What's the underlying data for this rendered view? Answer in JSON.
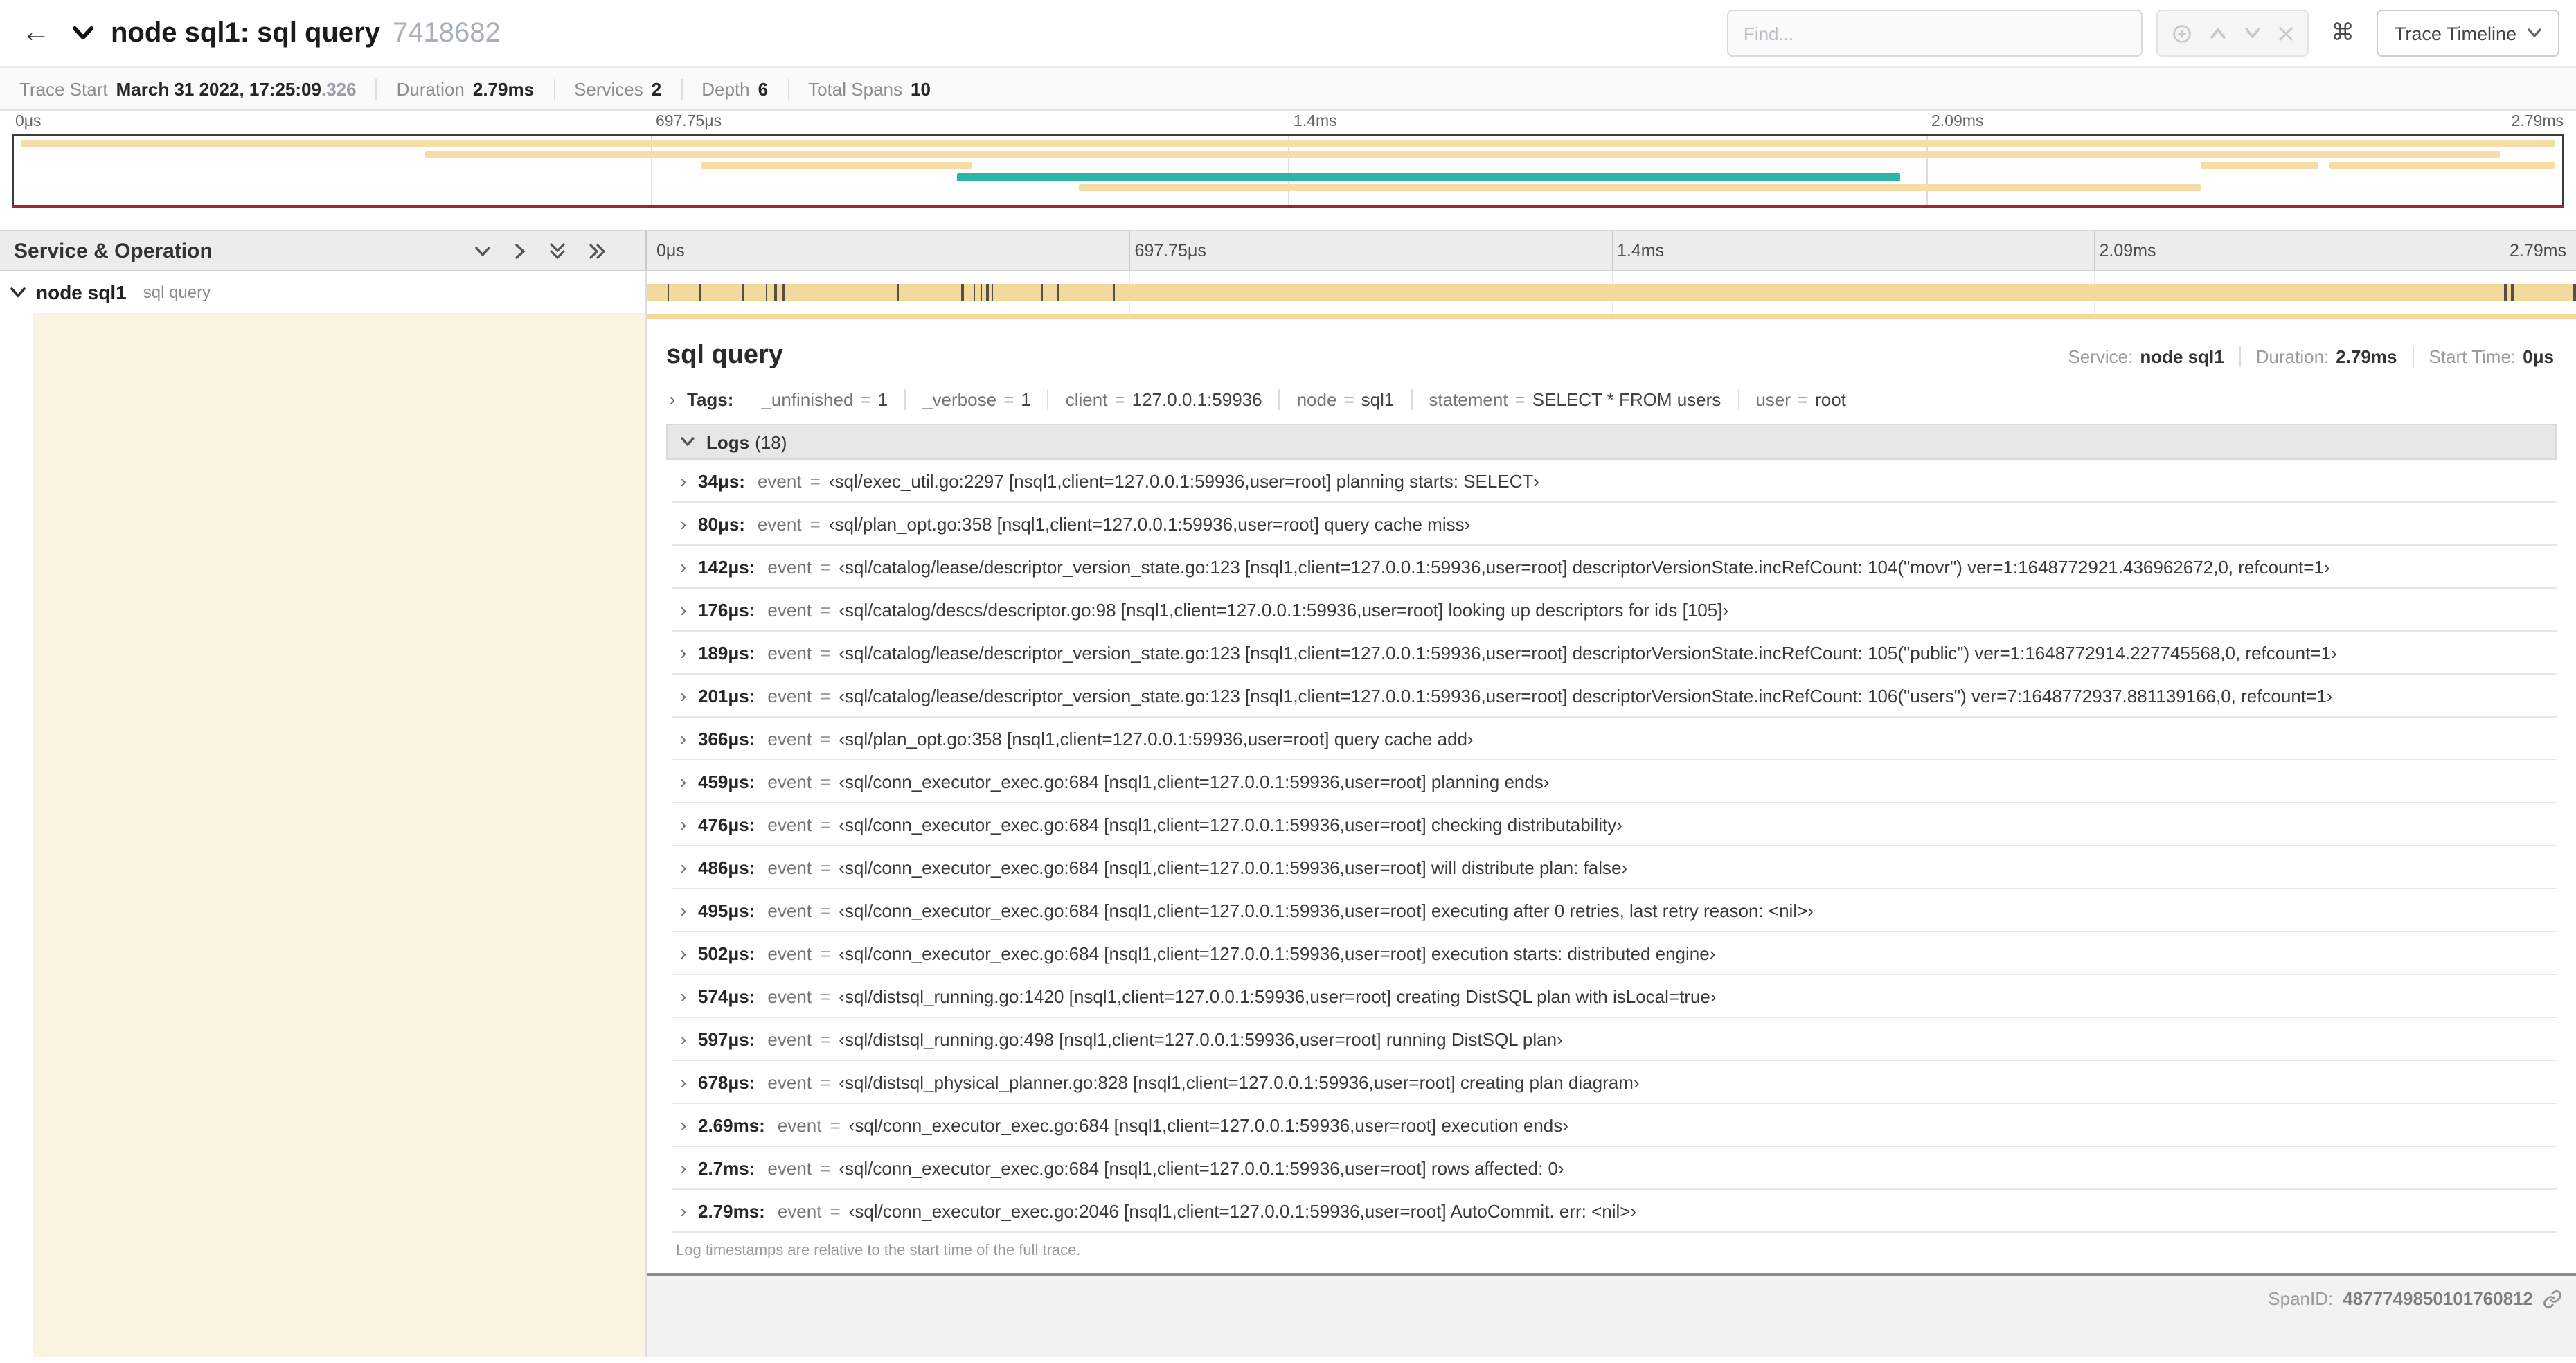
{
  "header": {
    "back_glyph": "←",
    "title": "node sql1: sql query",
    "trace_id": "7418682",
    "find_placeholder": "Find...",
    "cmd_glyph": "⌘",
    "trace_timeline_label": "Trace Timeline"
  },
  "summary": {
    "trace_start_label": "Trace Start",
    "trace_start_value": "March 31 2022, 17:25:09",
    "trace_start_suffix": ".326",
    "duration_label": "Duration",
    "duration_value": "2.79ms",
    "services_label": "Services",
    "services_value": "2",
    "depth_label": "Depth",
    "depth_value": "6",
    "spans_label": "Total Spans",
    "spans_value": "10"
  },
  "timeline": {
    "duration_us": 2790,
    "ticks": [
      "0μs",
      "697.75μs",
      "1.4ms",
      "2.09ms",
      "2.79ms"
    ]
  },
  "minimap": {
    "colors": {
      "tan": "#f5dda5",
      "teal": "#2ab5a7"
    },
    "bars": [
      {
        "r": 0,
        "l": 0.3,
        "w": 99.4,
        "c": "tan"
      },
      {
        "r": 1,
        "l": 16.2,
        "w": 81.3,
        "c": "tan"
      },
      {
        "r": 2,
        "l": 27.0,
        "w": 10.6,
        "c": "tan"
      },
      {
        "r": 2,
        "l": 85.8,
        "w": 4.6,
        "c": "tan"
      },
      {
        "r": 2,
        "l": 90.8,
        "w": 8.9,
        "c": "tan"
      },
      {
        "r": 3,
        "l": 37.0,
        "w": 37.0,
        "c": "teal"
      },
      {
        "r": 4,
        "l": 41.8,
        "w": 44.0,
        "c": "tan"
      }
    ]
  },
  "left_panel": {
    "title": "Service & Operation"
  },
  "span": {
    "service": "node sql1",
    "operation": "sql query"
  },
  "detail": {
    "title": "sql query",
    "meta": [
      {
        "label": "Service:",
        "value": "node sql1"
      },
      {
        "label": "Duration:",
        "value": "2.79ms"
      },
      {
        "label": "Start Time:",
        "value": "0μs"
      }
    ],
    "tags_label": "Tags:",
    "chev": "›",
    "eq": "=",
    "event_key": "event",
    "tags": [
      {
        "key": "_unfinished",
        "value": "1"
      },
      {
        "key": "_verbose",
        "value": "1"
      },
      {
        "key": "client",
        "value": "127.0.0.1:59936"
      },
      {
        "key": "node",
        "value": "sql1"
      },
      {
        "key": "statement",
        "value": "SELECT * FROM users"
      },
      {
        "key": "user",
        "value": "root"
      }
    ],
    "logs_label": "Logs",
    "logs_count": "(18)",
    "logs": [
      {
        "t": "34μs:",
        "us": 34,
        "event": "‹sql/exec_util.go:2297 [nsql1,client=127.0.0.1:59936,user=root] planning starts: SELECT›"
      },
      {
        "t": "80μs:",
        "us": 80,
        "event": "‹sql/plan_opt.go:358 [nsql1,client=127.0.0.1:59936,user=root] query cache miss›"
      },
      {
        "t": "142μs:",
        "us": 142,
        "event": "‹sql/catalog/lease/descriptor_version_state.go:123 [nsql1,client=127.0.0.1:59936,user=root] descriptorVersionState.incRefCount: 104(\"movr\") ver=1:1648772921.436962672,0, refcount=1›"
      },
      {
        "t": "176μs:",
        "us": 176,
        "event": "‹sql/catalog/descs/descriptor.go:98 [nsql1,client=127.0.0.1:59936,user=root] looking up descriptors for ids [105]›"
      },
      {
        "t": "189μs:",
        "us": 189,
        "event": "‹sql/catalog/lease/descriptor_version_state.go:123 [nsql1,client=127.0.0.1:59936,user=root] descriptorVersionState.incRefCount: 105(\"public\") ver=1:1648772914.227745568,0, refcount=1›"
      },
      {
        "t": "201μs:",
        "us": 201,
        "event": "‹sql/catalog/lease/descriptor_version_state.go:123 [nsql1,client=127.0.0.1:59936,user=root] descriptorVersionState.incRefCount: 106(\"users\") ver=7:1648772937.881139166,0, refcount=1›"
      },
      {
        "t": "366μs:",
        "us": 366,
        "event": "‹sql/plan_opt.go:358 [nsql1,client=127.0.0.1:59936,user=root] query cache add›"
      },
      {
        "t": "459μs:",
        "us": 459,
        "event": "‹sql/conn_executor_exec.go:684 [nsql1,client=127.0.0.1:59936,user=root] planning ends›"
      },
      {
        "t": "476μs:",
        "us": 476,
        "event": "‹sql/conn_executor_exec.go:684 [nsql1,client=127.0.0.1:59936,user=root] checking distributability›"
      },
      {
        "t": "486μs:",
        "us": 486,
        "event": "‹sql/conn_executor_exec.go:684 [nsql1,client=127.0.0.1:59936,user=root] will distribute plan: false›"
      },
      {
        "t": "495μs:",
        "us": 495,
        "event": "‹sql/conn_executor_exec.go:684 [nsql1,client=127.0.0.1:59936,user=root] executing after 0 retries, last retry reason: <nil>›"
      },
      {
        "t": "502μs:",
        "us": 502,
        "event": "‹sql/conn_executor_exec.go:684 [nsql1,client=127.0.0.1:59936,user=root] execution starts: distributed engine›"
      },
      {
        "t": "574μs:",
        "us": 574,
        "event": "‹sql/distsql_running.go:1420 [nsql1,client=127.0.0.1:59936,user=root] creating DistSQL plan with isLocal=true›"
      },
      {
        "t": "597μs:",
        "us": 597,
        "event": "‹sql/distsql_running.go:498 [nsql1,client=127.0.0.1:59936,user=root] running DistSQL plan›"
      },
      {
        "t": "678μs:",
        "us": 678,
        "event": "‹sql/distsql_physical_planner.go:828 [nsql1,client=127.0.0.1:59936,user=root] creating plan diagram›"
      },
      {
        "t": "2.69ms:",
        "us": 2690,
        "event": "‹sql/conn_executor_exec.go:684 [nsql1,client=127.0.0.1:59936,user=root] execution ends›"
      },
      {
        "t": "2.7ms:",
        "us": 2700,
        "event": "‹sql/conn_executor_exec.go:684 [nsql1,client=127.0.0.1:59936,user=root] rows affected: 0›"
      },
      {
        "t": "2.79ms:",
        "us": 2790,
        "event": "‹sql/conn_executor_exec.go:2046 [nsql1,client=127.0.0.1:59936,user=root] AutoCommit. err: <nil>›"
      }
    ],
    "logs_note": "Log timestamps are relative to the start time of the full trace.",
    "span_id_label": "SpanID:",
    "span_id": "4877749850101760812"
  }
}
